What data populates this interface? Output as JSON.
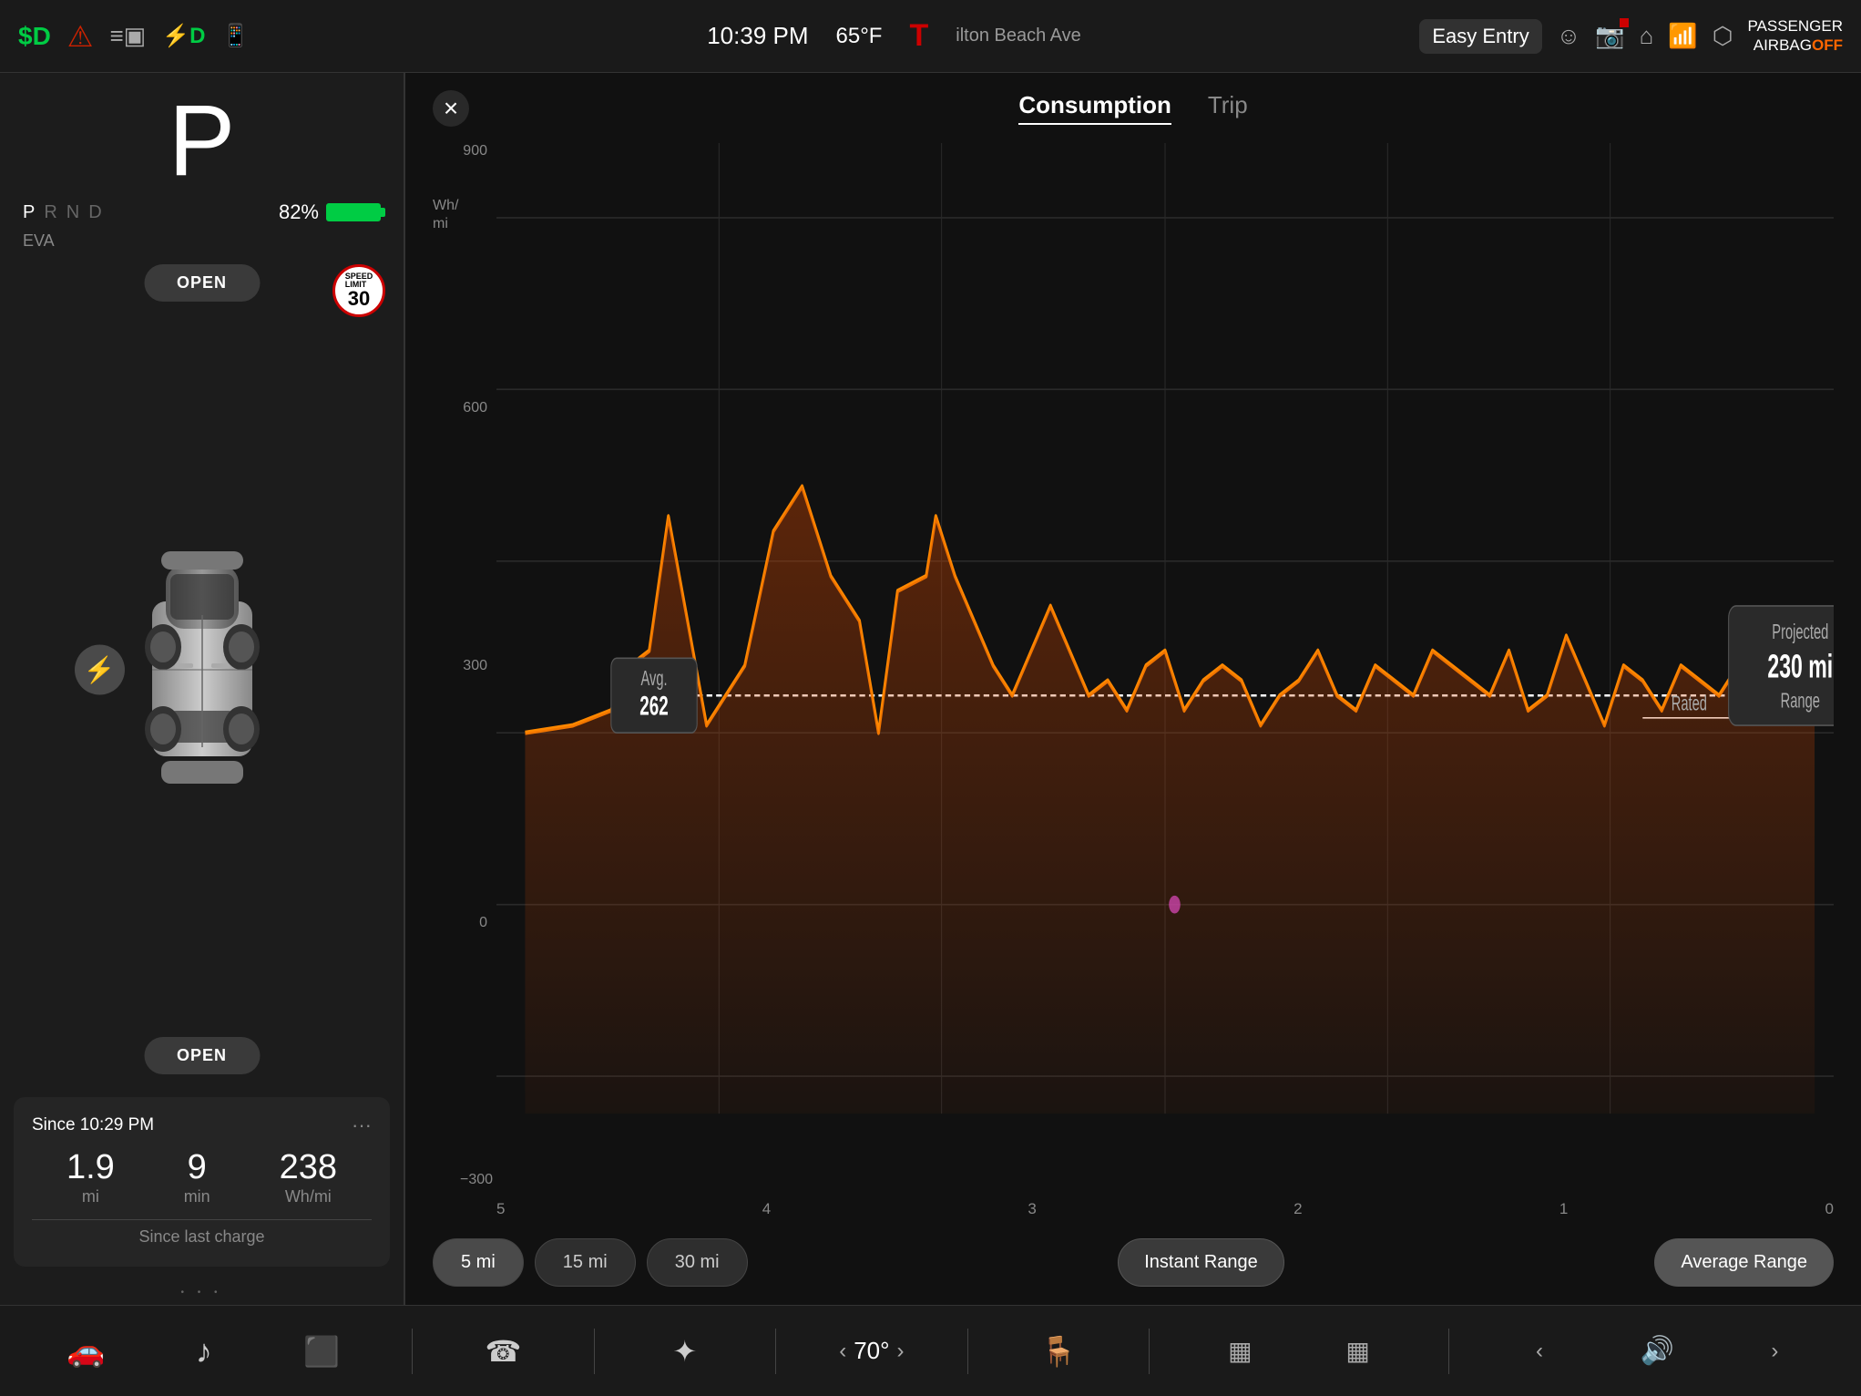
{
  "statusBar": {
    "leftIcons": [
      {
        "name": "dollar-d-icon",
        "symbol": "$D",
        "color": "green"
      },
      {
        "name": "person-alert-icon",
        "symbol": "⚠",
        "color": "red"
      }
    ],
    "centerIcons": [
      {
        "name": "menu-icon",
        "symbol": "≡",
        "color": "white"
      },
      {
        "name": "ev-icon",
        "symbol": "⚡D",
        "color": "green"
      },
      {
        "name": "phone-icon",
        "symbol": "📱",
        "color": "white"
      }
    ],
    "time": "10:39 PM",
    "temp": "65°F",
    "teslaLogo": "T",
    "navText": "ilton Beach Ave",
    "easyEntry": "Easy Entry",
    "rightIcons": [
      {
        "name": "profile-icon",
        "symbol": "👤"
      },
      {
        "name": "camera-icon",
        "symbol": "📷"
      },
      {
        "name": "home-icon",
        "symbol": "🏠"
      },
      {
        "name": "wifi-icon",
        "symbol": "📶"
      },
      {
        "name": "bluetooth-icon",
        "symbol": "⬡"
      }
    ],
    "passengerAirbag": "PASSENGER\nAIRBAG",
    "airbagStatus": "OFF"
  },
  "leftPanel": {
    "gear": "P",
    "prnd": [
      "P",
      "R",
      "N",
      "D"
    ],
    "activeGear": "P",
    "batteryPercent": "82%",
    "evaLabel": "EVA",
    "openTopLabel": "OPEN",
    "openBottomLabel": "OPEN",
    "speedLimitLabel": "SPEED\nLIMIT",
    "speedLimit": "30",
    "statsTitle": "Since 10:29 PM",
    "statsMenuIcon": "···",
    "stats": [
      {
        "value": "1.9",
        "unit": "mi"
      },
      {
        "value": "9",
        "unit": "min"
      },
      {
        "value": "238",
        "unit": "Wh/mi"
      }
    ],
    "sinceLastCharge": "Since last charge"
  },
  "rightPanel": {
    "closeIcon": "×",
    "tabs": [
      {
        "label": "Consumption",
        "active": true
      },
      {
        "label": "Trip",
        "active": false
      }
    ],
    "chart": {
      "yLabels": [
        "900",
        "600",
        "300",
        "0",
        "-300"
      ],
      "xLabels": [
        "5",
        "4",
        "3",
        "2",
        "1",
        "0"
      ],
      "whMiLabel": "Wh/\nmi",
      "avgLabel": "Avg.\n262",
      "avgValue": "262",
      "ratedLabel": "Rated",
      "projectedLabel": "Projected",
      "projectedValue": "230 mi",
      "projectedUnit": "Range"
    },
    "buttons": [
      {
        "label": "5 mi",
        "active": true
      },
      {
        "label": "15 mi",
        "active": false
      },
      {
        "label": "30 mi",
        "active": false
      },
      {
        "label": "Instant Range",
        "active": false
      },
      {
        "label": "Average Range",
        "active": true
      }
    ]
  },
  "taskbar": {
    "icons": [
      {
        "name": "car-icon",
        "symbol": "🚗"
      },
      {
        "name": "music-icon",
        "symbol": "♪"
      },
      {
        "name": "media-icon",
        "symbol": "▣"
      },
      {
        "name": "phone-call-icon",
        "symbol": "☎"
      },
      {
        "name": "fan-icon",
        "symbol": "✦"
      },
      {
        "name": "seat-icon",
        "symbol": "🪑"
      },
      {
        "name": "rear-heat-icon",
        "symbol": "▦"
      },
      {
        "name": "front-heat-icon",
        "symbol": "▦"
      },
      {
        "name": "volume-icon",
        "symbol": "🔊"
      }
    ],
    "tempLeft": "<",
    "temp": "70°",
    "tempRight": ">"
  }
}
